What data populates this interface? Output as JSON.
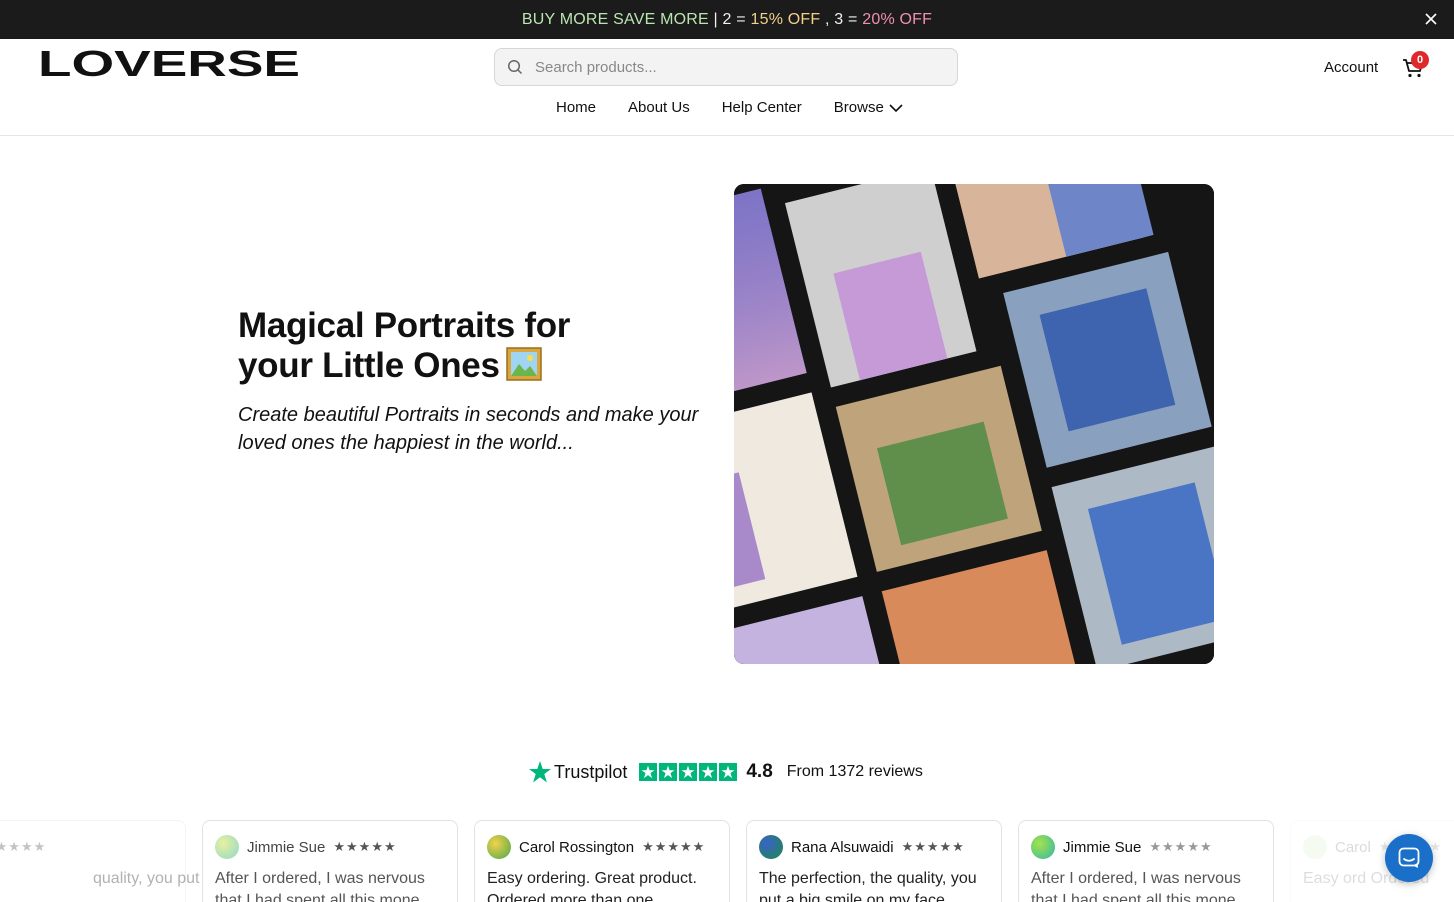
{
  "announcement": {
    "part1": "BUY MORE SAVE MORE",
    "part2": " | 2 = ",
    "part3": "15% OFF",
    "part4": " , 3 = ",
    "part5": "20% OFF"
  },
  "header": {
    "brand": "LOVERSE",
    "search_placeholder": "Search products...",
    "account_label": "Account",
    "cart_count": "0"
  },
  "nav": {
    "items": [
      "Home",
      "About Us",
      "Help Center",
      "Browse"
    ]
  },
  "hero": {
    "title_line1": "Magical Portraits for",
    "title_line2": "your Little Ones",
    "subtitle": "Create beautiful Portraits in seconds and make your loved ones the happiest in the world..."
  },
  "trustpilot": {
    "brand": "Trustpilot",
    "score": "4.8",
    "reviews_text": "From 1372 reviews"
  },
  "reviews": [
    {
      "name": "",
      "stars": "★★★★★",
      "text": "quality, you put a big smile on my face",
      "avatar_color": "#c8e6b0"
    },
    {
      "name": "Jimmie Sue",
      "stars": "★★★★★",
      "text": "After I ordered, I was nervous that I had spent all this mone",
      "avatar_color": "#bfe8d0"
    },
    {
      "name": "Carol Rossington",
      "stars": "★★★★★",
      "text": "Easy ordering. Great product. Ordered more than one",
      "avatar_color": "#9ccd4f"
    },
    {
      "name": "Rana Alsuwaidi",
      "stars": "★★★★★",
      "text": "The perfection, the quality, you put a big smile on my face",
      "avatar_color": "#2a8a6a"
    },
    {
      "name": "Jimmie Sue",
      "stars": "★★★★★",
      "text": "After I ordered, I was nervous that I had spent all this mone",
      "avatar_color": "#6fd38a"
    },
    {
      "name": "Carol",
      "stars": "★★★★★",
      "text": "Easy ord Ordered",
      "avatar_color": "#c8e6b0"
    }
  ],
  "colors": {
    "announcement_bg": "#1b1b1b",
    "trustpilot_green": "#00b67a",
    "chat_blue": "#1a6fc9",
    "badge_red": "#e0282c"
  },
  "icons": [
    "close-icon",
    "search-icon",
    "cart-icon",
    "chevron-down-icon",
    "trustpilot-star-icon",
    "chat-icon",
    "framed-picture-emoji"
  ]
}
